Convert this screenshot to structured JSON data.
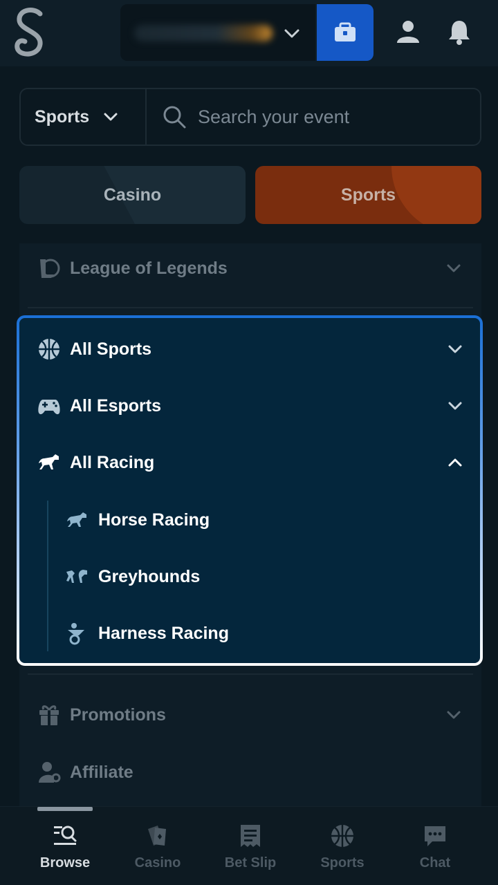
{
  "header": {
    "wallet_balance": "",
    "icons": [
      "stake-logo-icon",
      "chevron-down-icon",
      "wallet-icon",
      "user-icon",
      "bell-icon"
    ]
  },
  "search": {
    "category": "Sports",
    "placeholder": "Search your event"
  },
  "toggles": {
    "casino": "Casino",
    "sports": "Sports"
  },
  "menu": {
    "league": "League of Legends",
    "all_sports": "All Sports",
    "all_esports": "All Esports",
    "all_racing": "All Racing",
    "racing_children": [
      "Horse Racing",
      "Greyhounds",
      "Harness Racing"
    ],
    "promotions": "Promotions",
    "affiliate": "Affiliate"
  },
  "bottom_nav": {
    "items": [
      "Browse",
      "Casino",
      "Bet Slip",
      "Sports",
      "Chat"
    ],
    "active": "Browse"
  },
  "colors": {
    "background": "#0b1820",
    "accent_blue": "#1558c6",
    "sports_orange": "#7a2d0e",
    "highlight_fill": "#04263c"
  }
}
